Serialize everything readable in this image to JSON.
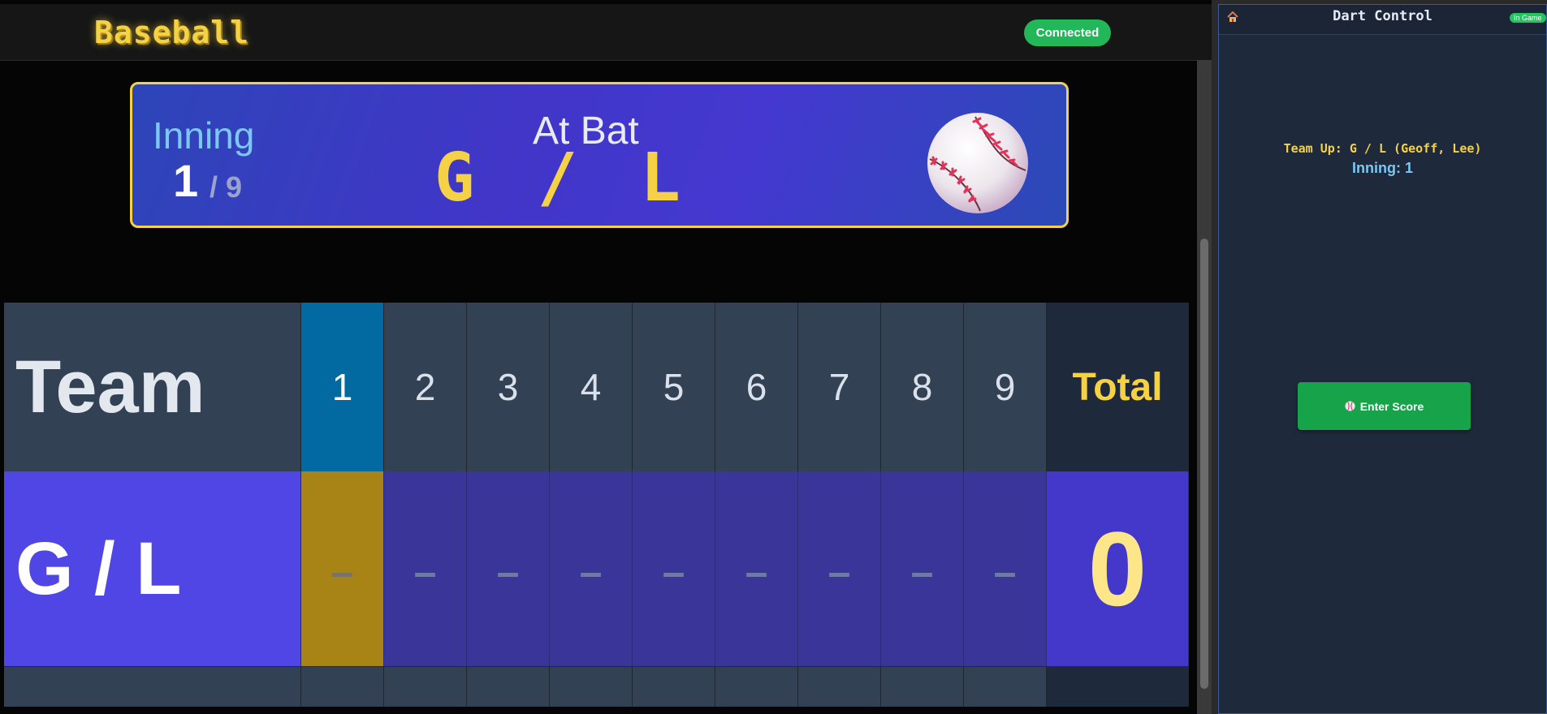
{
  "header": {
    "logo": "Baseball",
    "status": "Connected"
  },
  "banner": {
    "inning_label": "Inning",
    "inning_current": "1",
    "inning_total": "/ 9",
    "at_bat_label": "At Bat",
    "at_bat_team": "G / L",
    "ball_icon": "baseball-icon"
  },
  "scoreboard": {
    "team_header": "Team",
    "innings": [
      "1",
      "2",
      "3",
      "4",
      "5",
      "6",
      "7",
      "8",
      "9"
    ],
    "active_inning": 1,
    "total_header": "Total",
    "rows": [
      {
        "team": "G / L",
        "scores": [
          "–",
          "–",
          "–",
          "–",
          "–",
          "–",
          "–",
          "–",
          "–"
        ],
        "total": "0"
      }
    ]
  },
  "panel": {
    "title": "Dart Control",
    "badge": "In Game",
    "team_up": "Team Up: G / L (Geoff, Lee)",
    "inning_info": "Inning: 1",
    "enter_score_label": "Enter Score",
    "home_icon": "home-icon",
    "enter_icon": "baseball-icon"
  },
  "colors": {
    "accent_yellow": "#f4d145",
    "active_inning": "#0369a1",
    "active_score_cell": "#a88416",
    "team_row": "#4f46e5",
    "connected": "#22b85a"
  }
}
